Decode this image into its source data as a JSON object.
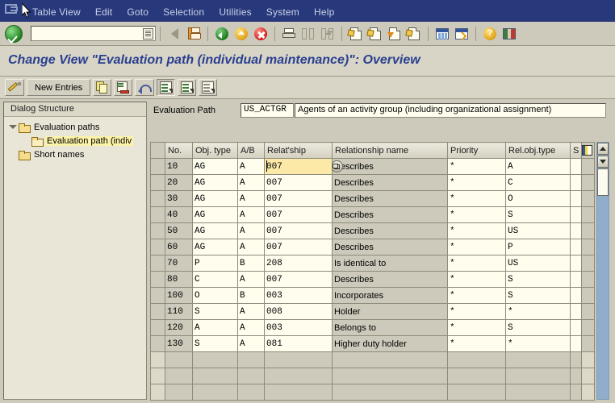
{
  "window": {
    "system_menu_icon": "system-menu-icon",
    "menus": [
      "Table View",
      "Edit",
      "Goto",
      "Selection",
      "Utilities",
      "System",
      "Help"
    ]
  },
  "toolbar": {
    "ok_button": "enter-ok-icon",
    "command_field_value": "",
    "command_field_placeholder": "",
    "buttons": [
      {
        "name": "back-arrow-icon",
        "label": ""
      },
      {
        "name": "save-icon",
        "label": ""
      },
      {
        "name": "back-green-icon",
        "label": ""
      },
      {
        "name": "exit-yellow-icon",
        "label": ""
      },
      {
        "name": "cancel-red-icon",
        "label": ""
      },
      {
        "name": "print-icon",
        "label": ""
      },
      {
        "name": "find-icon",
        "label": ""
      },
      {
        "name": "find-next-icon",
        "label": ""
      },
      {
        "name": "first-page-icon",
        "label": ""
      },
      {
        "name": "previous-page-icon",
        "label": ""
      },
      {
        "name": "next-page-icon",
        "label": ""
      },
      {
        "name": "last-page-icon",
        "label": ""
      },
      {
        "name": "new-session-icon",
        "label": ""
      },
      {
        "name": "create-shortcut-icon",
        "label": ""
      },
      {
        "name": "help-icon",
        "label": ""
      },
      {
        "name": "layout-menu-icon",
        "label": ""
      }
    ]
  },
  "title": "Change View \"Evaluation path (individual maintenance)\": Overview",
  "apptoolbar": {
    "display_change_icon": "display-change-pencil-icon",
    "new_entries_label": "New Entries",
    "copy_icon": "copy-as-icon",
    "delete_icon": "delete-row-icon",
    "undo_icon": "undo-change-icon",
    "variable_list_icon": "select-all-icon",
    "details_icon": "select-block-icon",
    "deselect_icon": "deselect-all-icon"
  },
  "sidebar": {
    "header": "Dialog Structure",
    "items": [
      {
        "label": "Evaluation paths",
        "level": 0,
        "expanded": true,
        "selected": false
      },
      {
        "label": "Evaluation path (indiv",
        "level": 1,
        "expanded": false,
        "selected": true
      },
      {
        "label": "Short names",
        "level": 0,
        "expanded": false,
        "selected": false
      }
    ]
  },
  "detail": {
    "eval_path_label": "Evaluation Path",
    "eval_path_code": "US_ACTGR",
    "eval_path_description": "Agents of an activity group (including organizational assignment)"
  },
  "table": {
    "columns": [
      "No.",
      "Obj. type",
      "A/B",
      "Relat'ship",
      "Relationship name",
      "Priority",
      "Rel.obj.type",
      "S"
    ],
    "layout_icon": "table-settings-icon",
    "focused_cell": {
      "row": 0,
      "column": "Relat'ship",
      "value": "007"
    },
    "f4_overlay_icon": "f4-value-help-icon",
    "rows": [
      {
        "no": "10",
        "obj_type": "AG",
        "ab": "A",
        "relship": "007",
        "rel_name": "Describes",
        "priority": "*",
        "rel_obj_type": "A",
        "s": ""
      },
      {
        "no": "20",
        "obj_type": "AG",
        "ab": "A",
        "relship": "007",
        "rel_name": "Describes",
        "priority": "*",
        "rel_obj_type": "C",
        "s": ""
      },
      {
        "no": "30",
        "obj_type": "AG",
        "ab": "A",
        "relship": "007",
        "rel_name": "Describes",
        "priority": "*",
        "rel_obj_type": "O",
        "s": ""
      },
      {
        "no": "40",
        "obj_type": "AG",
        "ab": "A",
        "relship": "007",
        "rel_name": "Describes",
        "priority": "*",
        "rel_obj_type": "S",
        "s": ""
      },
      {
        "no": "50",
        "obj_type": "AG",
        "ab": "A",
        "relship": "007",
        "rel_name": "Describes",
        "priority": "*",
        "rel_obj_type": "US",
        "s": ""
      },
      {
        "no": "60",
        "obj_type": "AG",
        "ab": "A",
        "relship": "007",
        "rel_name": "Describes",
        "priority": "*",
        "rel_obj_type": "P",
        "s": ""
      },
      {
        "no": "70",
        "obj_type": "P",
        "ab": "B",
        "relship": "208",
        "rel_name": "Is identical to",
        "priority": "*",
        "rel_obj_type": "US",
        "s": ""
      },
      {
        "no": "80",
        "obj_type": "C",
        "ab": "A",
        "relship": "007",
        "rel_name": "Describes",
        "priority": "*",
        "rel_obj_type": "S",
        "s": ""
      },
      {
        "no": "100",
        "obj_type": "O",
        "ab": "B",
        "relship": "003",
        "rel_name": "Incorporates",
        "priority": "*",
        "rel_obj_type": "S",
        "s": ""
      },
      {
        "no": "110",
        "obj_type": "S",
        "ab": "A",
        "relship": "008",
        "rel_name": "Holder",
        "priority": "*",
        "rel_obj_type": "*",
        "s": ""
      },
      {
        "no": "120",
        "obj_type": "A",
        "ab": "A",
        "relship": "003",
        "rel_name": "Belongs to",
        "priority": "*",
        "rel_obj_type": "S",
        "s": ""
      },
      {
        "no": "130",
        "obj_type": "S",
        "ab": "A",
        "relship": "081",
        "rel_name": "Higher duty holder",
        "priority": "*",
        "rel_obj_type": "*",
        "s": ""
      }
    ],
    "empty_row_count": 3
  },
  "scrollbar": {
    "up_arrow": "scroll-up-icon",
    "down_arrow": "scroll-down-icon",
    "thumb": "scroll-thumb"
  },
  "colors": {
    "menubar": "#27397b",
    "toolbar": "#cdcabc",
    "title_text": "#2a3f8f",
    "field_background": "#fffdee",
    "focus_highlight": "#fce9a8",
    "tree_selection": "#fcf3a8",
    "scroll_track": "#90aecb"
  }
}
